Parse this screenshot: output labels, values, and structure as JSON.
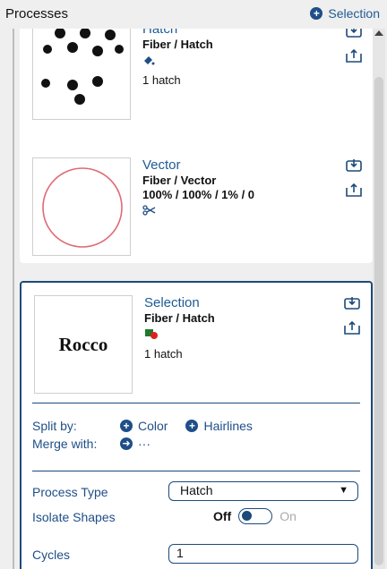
{
  "header": {
    "title": "Processes",
    "selection_button": "Selection"
  },
  "cards": [
    {
      "name": "Hatch",
      "type": "Fiber / Hatch",
      "count": "1 hatch",
      "thumb_icon": "scattered-dots"
    },
    {
      "name": "Vector",
      "type": "Fiber / Vector",
      "params": "100% / 100% / 1% / 0",
      "thumb_icon": "red-circle-outline"
    },
    {
      "name": "Selection",
      "type": "Fiber / Hatch",
      "count": "1 hatch",
      "thumb_text": "Rocco"
    }
  ],
  "selection_panel": {
    "split_by_label": "Split by:",
    "split_color": "Color",
    "split_hairlines": "Hairlines",
    "merge_with_label": "Merge with:",
    "merge_value": "···",
    "process_type_label": "Process Type",
    "process_type_value": "Hatch",
    "isolate_shapes_label": "Isolate Shapes",
    "isolate_off": "Off",
    "isolate_on": "On",
    "cycles_label": "Cycles",
    "cycles_value": "1"
  },
  "colors": {
    "accent": "#1f5b95",
    "accent_dark": "#1c4a7a",
    "vector_circle": "#e06a74",
    "swatch_green": "#1e7a2c",
    "swatch_red": "#e02020"
  }
}
